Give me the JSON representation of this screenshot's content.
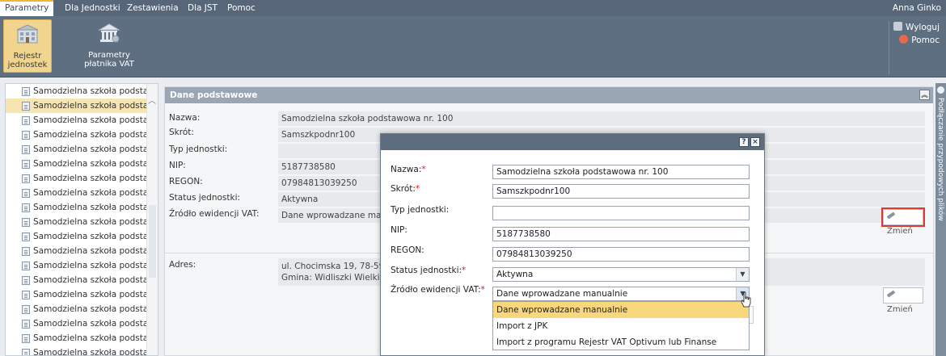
{
  "topbar": {
    "tabs": [
      {
        "label": "Parametry",
        "active": true
      },
      {
        "label": "Dla Jednostki",
        "active": false
      },
      {
        "label": "Zestawienia",
        "active": false
      },
      {
        "label": "Dla JST",
        "active": false
      },
      {
        "label": "Pomoc",
        "active": false
      }
    ],
    "user": "Anna Ginko"
  },
  "ribbon": {
    "buttons": [
      {
        "line1": "Rejestr",
        "line2": "jednostek",
        "active": true
      },
      {
        "line1": "Parametry",
        "line2": "płatnika VAT",
        "active": false
      }
    ],
    "right": {
      "logout": "Wyloguj",
      "help": "Pomoc"
    }
  },
  "left_list": {
    "items": [
      "Samodzielna szkoła podsta",
      "Samodzielna szkoła podsta",
      "Samodzielna szkoła podsta",
      "Samodzielna szkoła podsta",
      "Samodzielna szkoła podsta",
      "Samodzielna szkoła podsta",
      "Samodzielna szkoła podsta",
      "Samodzielna szkoła podsta",
      "Samodzielna szkoła podsta",
      "Samodzielna szkoła podsta",
      "Samodzielna szkoła podsta",
      "Samodzielna szkoła podsta",
      "Samodzielna szkoła podsta",
      "Samodzielna szkoła podsta",
      "Samodzielna szkoła podsta",
      "Samodzielna szkoła podsta",
      "Samodzielna szkoła podsta",
      "Samodzielna szkoła podsta",
      "Samodzielna szkoła podsta"
    ],
    "selected_index": 1
  },
  "main": {
    "section_title": "Dane podstawowe",
    "fields": [
      {
        "label": "Nazwa:",
        "value": "Samodzielna szkoła podstawowa nr. 100"
      },
      {
        "label": "Skrót:",
        "value": "Samszkpodnr100"
      },
      {
        "label": "Typ jednostki:",
        "value": ""
      },
      {
        "label": "NIP:",
        "value": "5187738580"
      },
      {
        "label": "REGON:",
        "value": "07984813039250"
      },
      {
        "label": "Status jednostki:",
        "value": "Aktywna"
      },
      {
        "label": "Źródło ewidencji VAT:",
        "value": "Dane wprowadzane man"
      }
    ],
    "address_label": "Adres:",
    "address_line1": "ul. Chocimska 19, 78-59",
    "address_line2": "Gmina: Widliszki Wielkie",
    "edit_label": "Zmień",
    "edit_label2": "Zmień"
  },
  "right_strip": {
    "text": "Podłączanie przypodowych plików"
  },
  "modal": {
    "help_btn": "?",
    "close_btn": "×",
    "fields": [
      {
        "label": "Nazwa:",
        "required": true,
        "value": "Samodzielna szkoła podstawowa nr. 100"
      },
      {
        "label": "Skrót:",
        "required": true,
        "value": "Samszkpodnr100"
      },
      {
        "label": "Typ jednostki:",
        "required": false,
        "value": ""
      },
      {
        "label": "NIP:",
        "required": false,
        "value": "5187738580"
      },
      {
        "label": "REGON:",
        "required": false,
        "value": "07984813039250"
      },
      {
        "label": "Status jednostki:",
        "required": true,
        "value": "Aktywna"
      },
      {
        "label": "Źródło ewidencji VAT:",
        "required": true,
        "value": "Dane wprowadzane manualnie"
      }
    ],
    "required_mark": "*",
    "dropdown_options": [
      "Dane wprowadzane manualnie",
      "Import z JPK",
      "Import z programu Rejestr VAT Optivum lub Finanse"
    ],
    "dropdown_selected_index": 0
  },
  "colors": {
    "topbar": "#576779",
    "ribbon": "#5e6f82",
    "active_tab_accent": "#f2b630",
    "selection": "#f9d77c",
    "required": "#d21f1f",
    "highlight_box": "#e03a2e"
  }
}
